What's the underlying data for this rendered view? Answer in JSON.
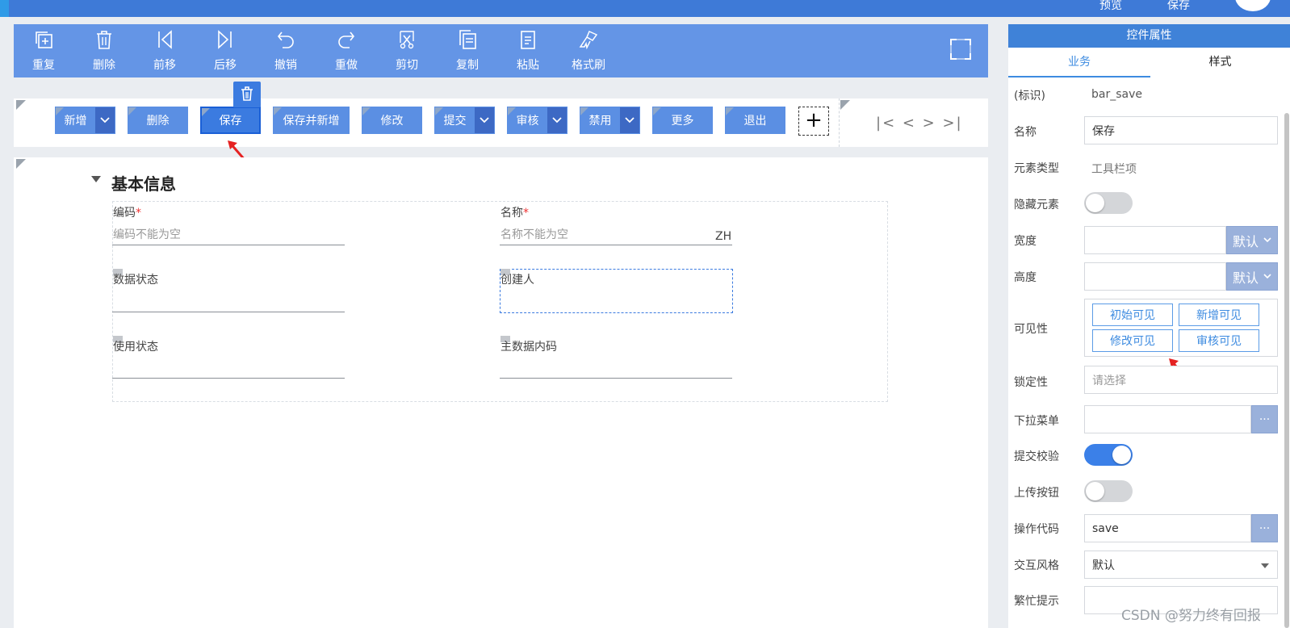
{
  "topbar": {
    "preview": "预览",
    "save": "保存"
  },
  "toolbar": {
    "tools": [
      {
        "label": "重复",
        "icon": "duplicate-icon"
      },
      {
        "label": "删除",
        "icon": "trash-icon"
      },
      {
        "label": "前移",
        "icon": "move-forward-icon"
      },
      {
        "label": "后移",
        "icon": "move-back-icon"
      },
      {
        "label": "撤销",
        "icon": "undo-icon"
      },
      {
        "label": "重做",
        "icon": "redo-icon"
      },
      {
        "label": "剪切",
        "icon": "scissors-icon"
      },
      {
        "label": "复制",
        "icon": "copy-icon"
      },
      {
        "label": "粘贴",
        "icon": "paste-icon"
      },
      {
        "label": "格式刷",
        "icon": "format-brush-icon"
      }
    ]
  },
  "buttonbar": {
    "buttons": [
      {
        "label": "新增",
        "dropdown": true
      },
      {
        "label": "删除",
        "dropdown": false
      },
      {
        "label": "保存",
        "dropdown": false,
        "selected": true
      },
      {
        "label": "保存并新增",
        "dropdown": false
      },
      {
        "label": "修改",
        "dropdown": false
      },
      {
        "label": "提交",
        "dropdown": true
      },
      {
        "label": "审核",
        "dropdown": true
      },
      {
        "label": "禁用",
        "dropdown": true
      },
      {
        "label": "更多",
        "dropdown": false
      },
      {
        "label": "退出",
        "dropdown": false
      }
    ],
    "add": "+",
    "nav": "|< < > >|"
  },
  "form": {
    "section": "基本信息",
    "fields": [
      {
        "label": "编码",
        "required": "*",
        "placeholder": "编码不能为空",
        "suffix": ""
      },
      {
        "label": "名称",
        "required": "*",
        "placeholder": "名称不能为空",
        "suffix": "ZH"
      },
      {
        "label": "数据状态",
        "required": "",
        "placeholder": "",
        "suffix": ""
      },
      {
        "label": "创建人",
        "required": "",
        "placeholder": "",
        "suffix": ""
      },
      {
        "label": "使用状态",
        "required": "",
        "placeholder": "",
        "suffix": ""
      },
      {
        "label": "主数据内码",
        "required": "",
        "placeholder": "",
        "suffix": ""
      }
    ]
  },
  "panel": {
    "title": "控件属性",
    "tabs": [
      "业务",
      "样式"
    ],
    "id_label": "(标识)",
    "id_value": "bar_save",
    "name_label": "名称",
    "name_value": "保存",
    "type_label": "元素类型",
    "type_value": "工具栏项",
    "hidden_label": "隐藏元素",
    "width_label": "宽度",
    "height_label": "高度",
    "default_label": "默认",
    "visibility_label": "可见性",
    "visibility_buttons": [
      "初始可见",
      "新增可见",
      "修改可见",
      "审核可见"
    ],
    "lock_label": "锁定性",
    "lock_placeholder": "请选择",
    "dropdown_label": "下拉菜单",
    "submit_check_label": "提交校验",
    "upload_label": "上传按钮",
    "opcode_label": "操作代码",
    "opcode_value": "save",
    "interaction_label": "交互风格",
    "interaction_value": "默认",
    "busy_label": "繁忙提示",
    "dots": "···",
    "toggles": {
      "hidden": false,
      "submit_check": true,
      "upload": false
    }
  },
  "watermark": "CSDN @努力终有回报"
}
